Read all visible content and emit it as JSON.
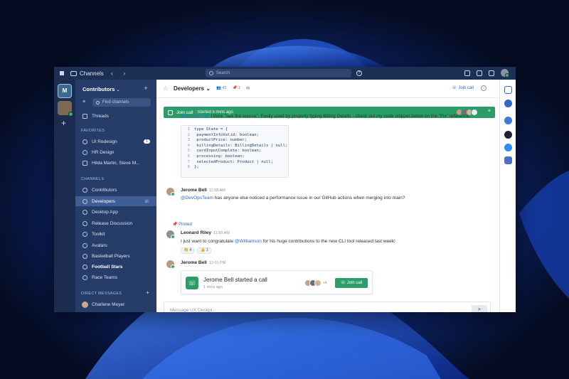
{
  "titlebar": {
    "title": "Channels",
    "nav": "‹ ›",
    "search_placeholder": "Search"
  },
  "rail": {
    "workspace_1_label": "M"
  },
  "sidebar": {
    "workspace": "Contributors",
    "find_placeholder": "Find channels",
    "threads": "Threads",
    "favorites_header": "FAVORITES",
    "favorites": [
      {
        "label": "UI Redesign",
        "badge": "1"
      },
      {
        "label": "HR Design"
      },
      {
        "label": "Hilda Martin, Steve M..."
      }
    ],
    "channels_header": "CHANNELS",
    "channels": [
      {
        "label": "Contributors"
      },
      {
        "label": "Developers",
        "active": true
      },
      {
        "label": "Desktop App"
      },
      {
        "label": "Release Discussion"
      },
      {
        "label": "Toolkit"
      },
      {
        "label": "Avatars"
      },
      {
        "label": "Basketball Players"
      },
      {
        "label": "Football Stars",
        "bold": true
      },
      {
        "label": "Race Teams"
      }
    ],
    "dm_header": "DIRECT MESSAGES",
    "dms": [
      {
        "label": "Charlene Meyer"
      }
    ]
  },
  "channel": {
    "name": "Developers",
    "members": "45",
    "pinned_count": "1",
    "join_call": "Join call"
  },
  "banner": {
    "label": "Join call",
    "started": "Started 5 mins ago",
    "close": "×"
  },
  "messages": {
    "intro_mention": "@Anders Holt",
    "intro_text": " I think \"see the source\". Easily used by properly typing Billing Details - check out my code snippet below on the \"Fix\" reference.",
    "code_lines": [
      "type State = {",
      "    paymentInfoValid: boolean;",
      "    productPrice: number;",
      "    billingDetails: BillingDetails | null;",
      "    cardInputComplete: boolean;",
      "    processing: boolean;",
      "    selectedProduct: Product | null;",
      "};"
    ],
    "msg1": {
      "author": "Jerome Bell",
      "time": "11:58 AM",
      "mention": "@DevOpsTeam",
      "text": " has anyone else noticed a performance issue in our GitHub actions when merging into main?"
    },
    "pinned": "Pinned",
    "msg2": {
      "author": "Leonard Riley",
      "time": "11:59 AM",
      "text_a": "I just want to congratulate ",
      "mention": "@Williamson",
      "text_b": " for his huge contributions to the new CLI tool released last week!",
      "reactions": [
        "👏 4",
        "👍 1"
      ]
    },
    "msg3": {
      "author": "Jerome Bell",
      "time": "12:01 PM"
    }
  },
  "call_card": {
    "title": "Jerome Bell started a call",
    "sub": "1 mins ago",
    "more": "+4",
    "join": "Join call"
  },
  "composer": {
    "placeholder": "Message UX Design...",
    "send": "➤"
  },
  "colors": {
    "titlebar": "#1c2f55",
    "sidebar": "#263d69",
    "active": "#3f5e96",
    "accent_green": "#2c9d68",
    "link_blue": "#2a6acb"
  }
}
